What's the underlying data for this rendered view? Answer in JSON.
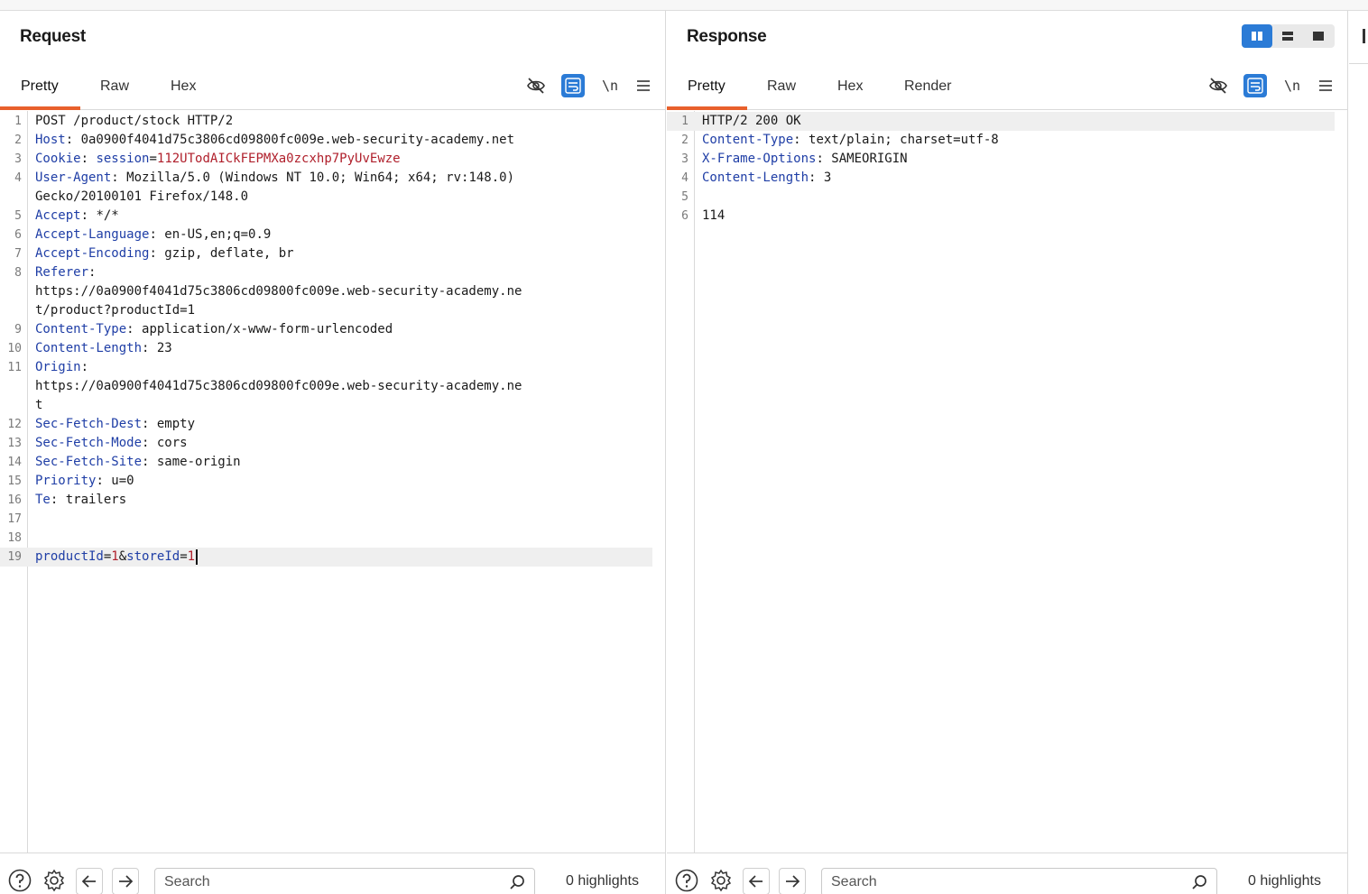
{
  "request": {
    "title": "Request",
    "tabs": [
      "Pretty",
      "Raw",
      "Hex"
    ],
    "active_tab": "Pretty",
    "lines": [
      {
        "n": "1",
        "k": "",
        "sep": "",
        "v": "",
        "plain": "POST /product/stock HTTP/2"
      },
      {
        "n": "2",
        "k": "Host",
        "sep": ": ",
        "v": "",
        "plain": "0a0900f4041d75c3806cd09800fc009e.web-security-academy.net"
      },
      {
        "n": "3",
        "k": "Cookie",
        "sep": ": ",
        "v": "",
        "plain": "",
        "cookie_name": "session",
        "cookie_value": "112UTodAICkFEPMXa0zcxhp7PyUvEwze"
      },
      {
        "n": "4",
        "k": "User-Agent",
        "sep": ": ",
        "v": "",
        "plain": "Mozilla/5.0 (Windows NT 10.0; Win64; x64; rv:148.0)"
      },
      {
        "n": "",
        "k": "",
        "sep": "",
        "v": "",
        "plain": "Gecko/20100101 Firefox/148.0"
      },
      {
        "n": "5",
        "k": "Accept",
        "sep": ": ",
        "v": "",
        "plain": "*/*"
      },
      {
        "n": "6",
        "k": "Accept-Language",
        "sep": ": ",
        "v": "",
        "plain": "en-US,en;q=0.9"
      },
      {
        "n": "7",
        "k": "Accept-Encoding",
        "sep": ": ",
        "v": "",
        "plain": "gzip, deflate, br"
      },
      {
        "n": "8",
        "k": "Referer",
        "sep": ":",
        "v": "",
        "plain": ""
      },
      {
        "n": "",
        "k": "",
        "sep": "",
        "v": "",
        "plain": "https://0a0900f4041d75c3806cd09800fc009e.web-security-academy.ne"
      },
      {
        "n": "",
        "k": "",
        "sep": "",
        "v": "",
        "plain": "t/product?productId=1"
      },
      {
        "n": "9",
        "k": "Content-Type",
        "sep": ": ",
        "v": "",
        "plain": "application/x-www-form-urlencoded"
      },
      {
        "n": "10",
        "k": "Content-Length",
        "sep": ": ",
        "v": "",
        "plain": "23"
      },
      {
        "n": "11",
        "k": "Origin",
        "sep": ":",
        "v": "",
        "plain": ""
      },
      {
        "n": "",
        "k": "",
        "sep": "",
        "v": "",
        "plain": "https://0a0900f4041d75c3806cd09800fc009e.web-security-academy.ne"
      },
      {
        "n": "",
        "k": "",
        "sep": "",
        "v": "",
        "plain": "t"
      },
      {
        "n": "12",
        "k": "Sec-Fetch-Dest",
        "sep": ": ",
        "v": "",
        "plain": "empty"
      },
      {
        "n": "13",
        "k": "Sec-Fetch-Mode",
        "sep": ": ",
        "v": "",
        "plain": "cors"
      },
      {
        "n": "14",
        "k": "Sec-Fetch-Site",
        "sep": ": ",
        "v": "",
        "plain": "same-origin"
      },
      {
        "n": "15",
        "k": "Priority",
        "sep": ": ",
        "v": "",
        "plain": "u=0"
      },
      {
        "n": "16",
        "k": "Te",
        "sep": ": ",
        "v": "",
        "plain": "trailers"
      },
      {
        "n": "17",
        "k": "",
        "sep": "",
        "v": "",
        "plain": ""
      },
      {
        "n": "18",
        "k": "",
        "sep": "",
        "v": "",
        "plain": ""
      },
      {
        "n": "19",
        "k": "",
        "sep": "",
        "v": "",
        "plain": "",
        "body": true,
        "params": [
          {
            "k": "productId",
            "v": "1"
          },
          {
            "k": "storeId",
            "v": "1"
          }
        ]
      }
    ],
    "search_placeholder": "Search",
    "highlights": "0 highlights"
  },
  "response": {
    "title": "Response",
    "tabs": [
      "Pretty",
      "Raw",
      "Hex",
      "Render"
    ],
    "active_tab": "Pretty",
    "lines": [
      {
        "n": "1",
        "k": "",
        "sep": "",
        "v": "",
        "plain": "HTTP/2 200 OK"
      },
      {
        "n": "2",
        "k": "Content-Type",
        "sep": ": ",
        "v": "",
        "plain": "text/plain; charset=utf-8"
      },
      {
        "n": "3",
        "k": "X-Frame-Options",
        "sep": ": ",
        "v": "",
        "plain": "SAMEORIGIN"
      },
      {
        "n": "4",
        "k": "Content-Length",
        "sep": ": ",
        "v": "",
        "plain": "3"
      },
      {
        "n": "5",
        "k": "",
        "sep": "",
        "v": "",
        "plain": ""
      },
      {
        "n": "6",
        "k": "",
        "sep": "",
        "v": "",
        "plain": "114"
      }
    ],
    "search_placeholder": "Search",
    "highlights": "0 highlights"
  },
  "colors": {
    "accent": "#e8602c",
    "blue": "#2b7bd6",
    "header_key": "#1f3ea6",
    "value_red": "#b0202c"
  },
  "icons": {
    "hide": "eye-off-icon",
    "wrap": "word-wrap-icon",
    "newline": "\\n",
    "menu": "hamburger-menu-icon",
    "help": "help-circle-icon",
    "settings": "gear-icon",
    "back": "arrow-left-icon",
    "forward": "arrow-right-icon",
    "search": "magnifier-icon"
  }
}
